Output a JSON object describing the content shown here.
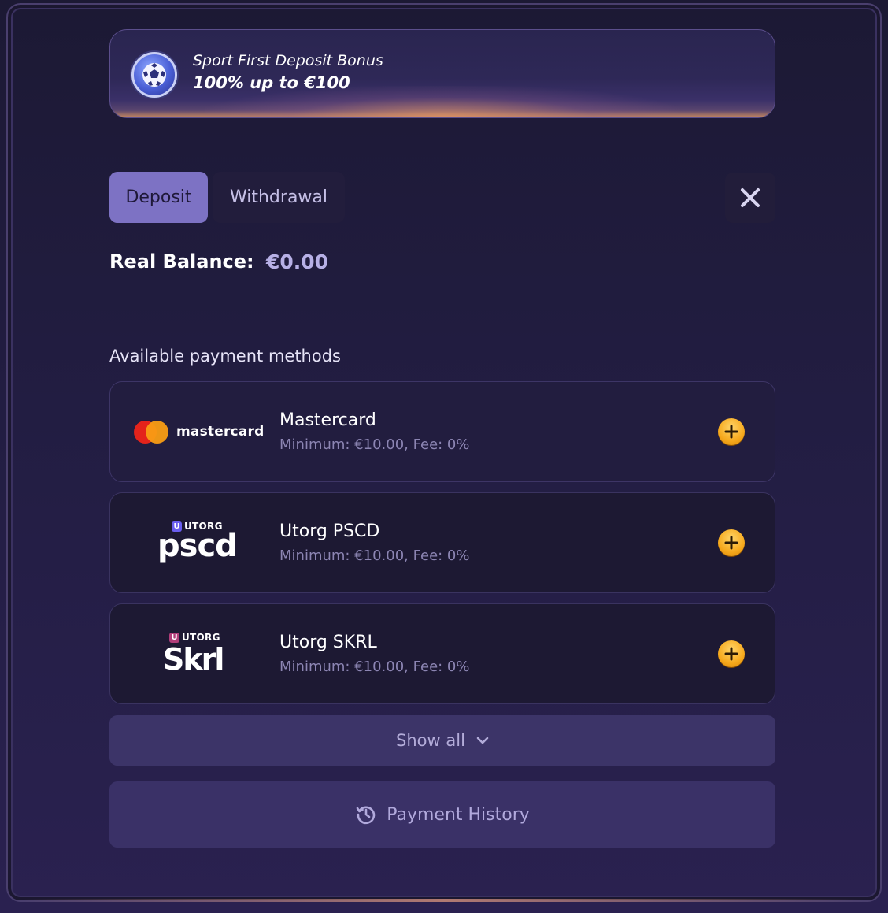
{
  "bonus": {
    "title": "Sport First Deposit Bonus",
    "amount": "100% up to €100",
    "icon": "football-icon"
  },
  "tabs": [
    {
      "label": "Deposit",
      "active": true
    },
    {
      "label": "Withdrawal",
      "active": false
    }
  ],
  "close_icon": "close-icon",
  "balance": {
    "label": "Real Balance:",
    "value": "€0.00"
  },
  "payment_section": {
    "title": "Available payment methods",
    "methods": [
      {
        "name": "Mastercard",
        "info": "Minimum: €10.00, Fee: 0%",
        "logo_text": "mastercard"
      },
      {
        "name": "Utorg PSCD",
        "info": "Minimum: €10.00, Fee: 0%",
        "logo_small": "UTORG",
        "logo_big": "pscd",
        "logo_badge": "U"
      },
      {
        "name": "Utorg SKRL",
        "info": "Minimum: €10.00, Fee: 0%",
        "logo_small": "UTORG",
        "logo_big": "Skrl",
        "logo_badge": "U"
      }
    ]
  },
  "show_all": {
    "label": "Show all"
  },
  "history": {
    "label": "Payment History"
  },
  "colors": {
    "accent": "#7d72c4",
    "add_button": "#f6a91d",
    "background": "#221d42"
  }
}
